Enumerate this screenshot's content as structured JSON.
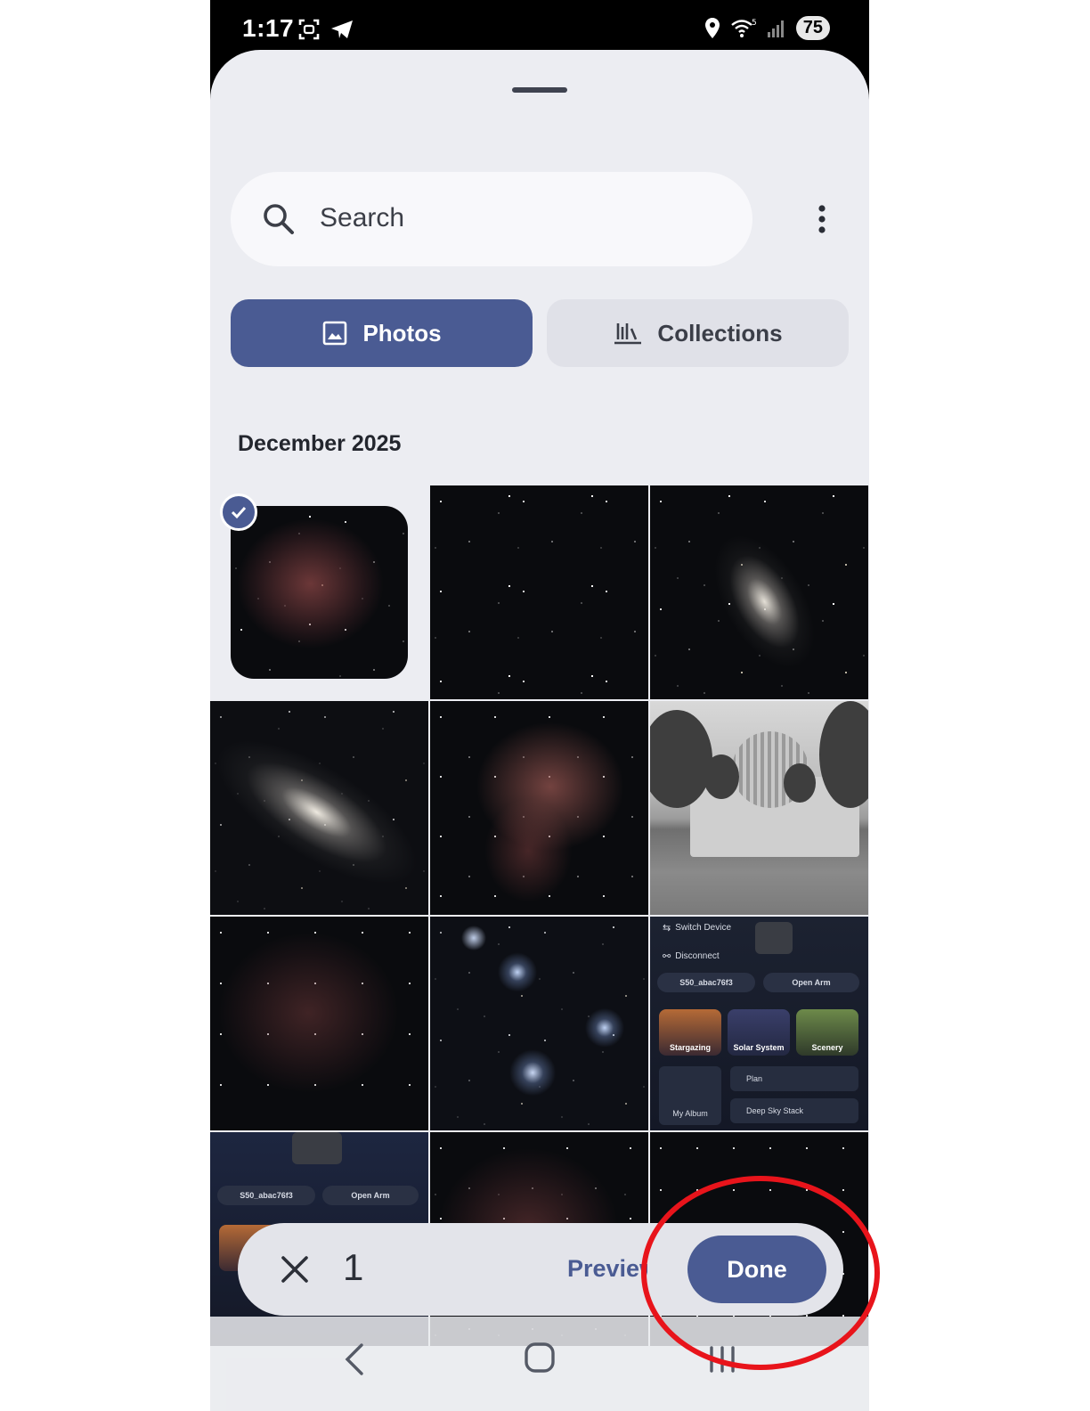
{
  "status_bar": {
    "time": "1:17",
    "battery": "75",
    "icons": [
      "screenshot-icon",
      "telegram-icon",
      "location-icon",
      "wifi-icon",
      "signal-icon",
      "battery-icon"
    ]
  },
  "search": {
    "placeholder": "Search"
  },
  "tabs": [
    {
      "label": "Photos",
      "icon": "image-icon",
      "selected": true
    },
    {
      "label": "Collections",
      "icon": "collections-icon",
      "selected": false
    }
  ],
  "section": {
    "title": "December 2025"
  },
  "app_screenshot": {
    "switch_device": "Switch Device",
    "disconnect": "Disconnect",
    "device_name": "S50_abac76f3",
    "open_arm": "Open Arm",
    "stargazing": "Stargazing",
    "solar_system": "Solar System",
    "scenery": "Scenery",
    "my_album": "My Album",
    "plan": "Plan",
    "deep_sky_stack": "Deep Sky Stack"
  },
  "selection_bar": {
    "count": "1",
    "preview_label": "Preview",
    "done_label": "Done"
  },
  "colors": {
    "accent": "#4a5b93",
    "sheet_bg": "#ecedf2",
    "annotation": "#e8141b"
  }
}
